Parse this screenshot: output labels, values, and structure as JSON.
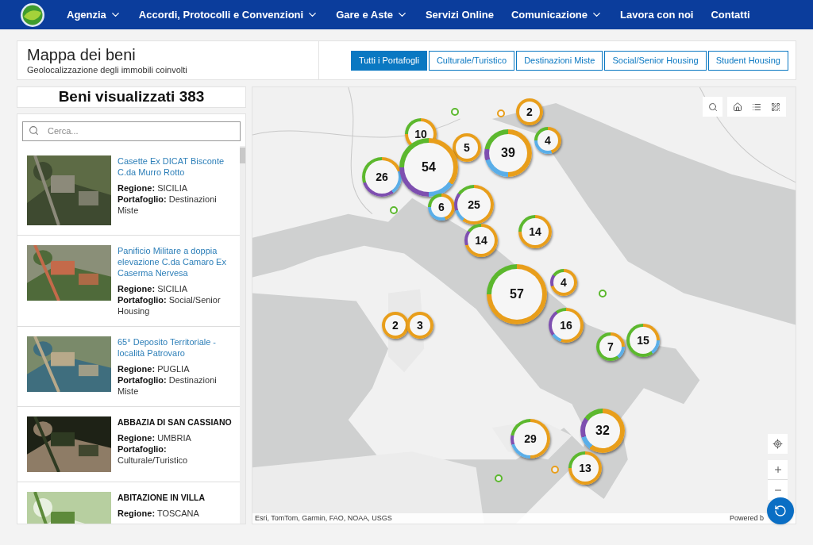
{
  "nav": {
    "items": [
      {
        "label": "Agenzia",
        "has_menu": true
      },
      {
        "label": "Accordi, Protocolli e Convenzioni",
        "has_menu": true
      },
      {
        "label": "Gare e Aste",
        "has_menu": true
      },
      {
        "label": "Servizi Online",
        "has_menu": false
      },
      {
        "label": "Comunicazione",
        "has_menu": true
      },
      {
        "label": "Lavora con noi",
        "has_menu": false
      },
      {
        "label": "Contatti",
        "has_menu": false
      }
    ]
  },
  "header": {
    "title": "Mappa dei beni",
    "subtitle": "Geolocalizzazione degli immobili coinvolti",
    "filters": [
      {
        "label": "Tutti i Portafogli",
        "selected": true
      },
      {
        "label": "Culturale/Turistico",
        "selected": false
      },
      {
        "label": "Destinazioni Miste",
        "selected": false
      },
      {
        "label": "Social/Senior Housing",
        "selected": false
      },
      {
        "label": "Student Housing",
        "selected": false
      }
    ]
  },
  "count_title": "Beni visualizzati 383",
  "search": {
    "placeholder": "Cerca..."
  },
  "items": [
    {
      "kind": "link",
      "title": "Casette Ex DICAT Bisconte C.da Murro Rotto",
      "region_label": "Regione:",
      "region": "SICILIA",
      "portfolio_label": "Portafoglio:",
      "portfolio": "Destinazioni Miste"
    },
    {
      "kind": "link",
      "title": "Panificio Militare a doppia elevazione C.da Camaro Ex Caserma Nervesa",
      "region_label": "Regione:",
      "region": "SICILIA",
      "portfolio_label": "Portafoglio:",
      "portfolio": "Social/Senior Housing"
    },
    {
      "kind": "link",
      "title": "65° Deposito Territoriale - località Patrovaro",
      "region_label": "Regione:",
      "region": "PUGLIA",
      "portfolio_label": "Portafoglio:",
      "portfolio": "Destinazioni Miste"
    },
    {
      "kind": "plain",
      "title": "ABBAZIA DI SAN CASSIANO",
      "region_label": "Regione:",
      "region": "UMBRIA",
      "portfolio_label": "Portafoglio:",
      "portfolio": "Culturale/Turistico"
    },
    {
      "kind": "plain",
      "title": "ABITAZIONE IN VILLA",
      "region_label": "Regione:",
      "region": "TOSCANA"
    }
  ],
  "map": {
    "clusters": [
      {
        "count": "2"
      },
      {
        "count": "10"
      },
      {
        "count": "4"
      },
      {
        "count": "5"
      },
      {
        "count": "39"
      },
      {
        "count": "26"
      },
      {
        "count": "54"
      },
      {
        "count": "6"
      },
      {
        "count": "25"
      },
      {
        "count": "14"
      },
      {
        "count": "14"
      },
      {
        "count": "57"
      },
      {
        "count": "4"
      },
      {
        "count": "2"
      },
      {
        "count": "3"
      },
      {
        "count": "16"
      },
      {
        "count": "7"
      },
      {
        "count": "15"
      },
      {
        "count": "29"
      },
      {
        "count": "32"
      },
      {
        "count": "13"
      }
    ],
    "attribution": "Esri, TomTom, Garmin, FAO, NOAA, USGS",
    "powered": "Powered b"
  }
}
